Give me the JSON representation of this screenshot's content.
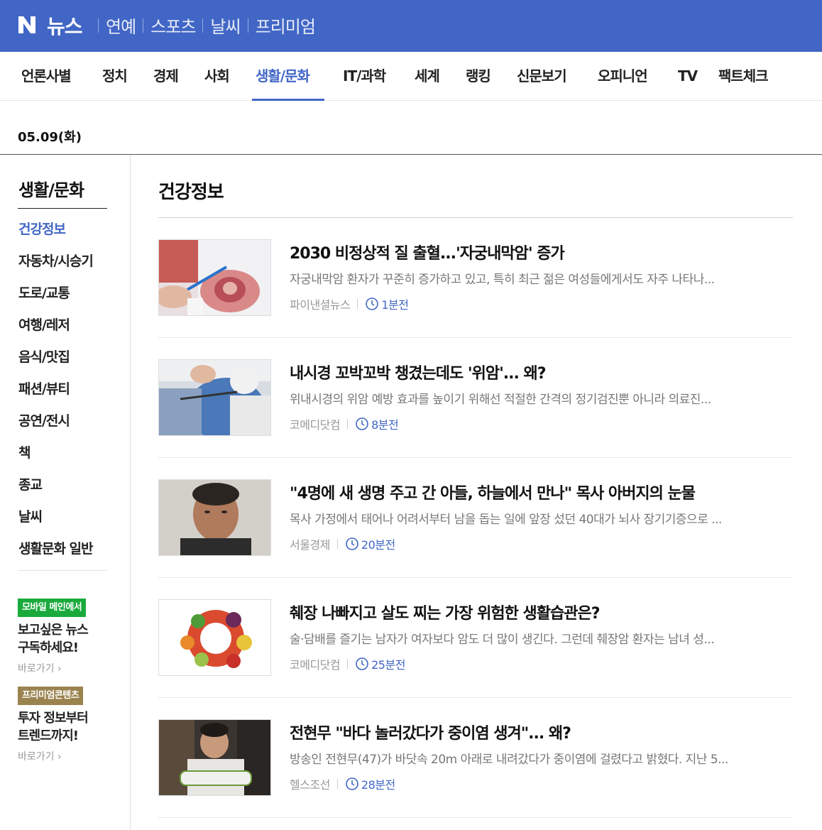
{
  "header": {
    "logo_letter": "N",
    "logo_text": "뉴스",
    "top_links": [
      "연예",
      "스포츠",
      "날씨",
      "프리미엄"
    ],
    "brand_color": "#4166c6"
  },
  "categories": [
    "언론사별",
    "정치",
    "경제",
    "사회",
    "생활/문화",
    "IT/과학",
    "세계",
    "랭킹",
    "신문보기",
    "오피니언",
    "TV",
    "팩트체크"
  ],
  "active_category": "생활/문화",
  "date": "05.09(화)",
  "sidebar": {
    "title": "생활/문화",
    "items": [
      "건강정보",
      "자동차/시승기",
      "도로/교통",
      "여행/레저",
      "음식/맛집",
      "패션/뷰티",
      "공연/전시",
      "책",
      "종교",
      "날씨",
      "생활문화 일반"
    ],
    "active_item": "건강정보",
    "promos": [
      {
        "badge": "모바일 메인에서",
        "line1": "보고싶은 뉴스",
        "line2": "구독하세요!",
        "link": "바로가기"
      },
      {
        "badge": "프리미엄콘텐츠",
        "line1": "투자 정보부터",
        "line2": "트렌드까지!",
        "link": "바로가기"
      }
    ]
  },
  "main": {
    "title": "건강정보",
    "articles": [
      {
        "headline": "2030 비정상적 질 출혈...'자궁내막암' 증가",
        "summary": "자궁내막암 환자가 꾸준히 증가하고 있고, 특히 최근 젊은 여성들에게서도 자주 나타나...",
        "press": "파이낸셜뉴스",
        "time": "1분전",
        "thumb": "uterus-model-photo"
      },
      {
        "headline": "내시경 꼬박꼬박 챙겼는데도 '위암'... 왜?",
        "summary": "위내시경의 위암 예방 효과를 높이기 위해선 적절한 간격의 정기검진뿐 아니라 의료진...",
        "press": "코메디닷컴",
        "time": "8분전",
        "thumb": "endoscopy-photo"
      },
      {
        "headline": "\"4명에 새 생명 주고 간 아들, 하늘에서 만나\" 목사 아버지의 눈물",
        "summary": "목사 가정에서 태어나 어려서부터 남을 돕는 일에 앞장 섰던 40대가 뇌사 장기기증으로 ...",
        "press": "서울경제",
        "time": "20분전",
        "thumb": "portrait-photo"
      },
      {
        "headline": "췌장 나빠지고 살도 찌는 가장 위험한 생활습관은?",
        "summary": "술·담배를 즐기는 남자가 여자보다 암도 더 많이 생긴다. 그런데 췌장암 환자는 남녀 성...",
        "press": "코메디닷컴",
        "time": "25분전",
        "thumb": "vegetables-plate-photo"
      },
      {
        "headline": "전현무 \"바다 놀러갔다가 중이염 생겨\"... 왜?",
        "summary": "방송인 전현무(47)가 바닷속 20m 아래로 내려갔다가 중이염에 걸렸다고 밝혔다. 지난 5...",
        "press": "헬스조선",
        "time": "28분전",
        "thumb": "tv-show-still-photo"
      }
    ]
  }
}
